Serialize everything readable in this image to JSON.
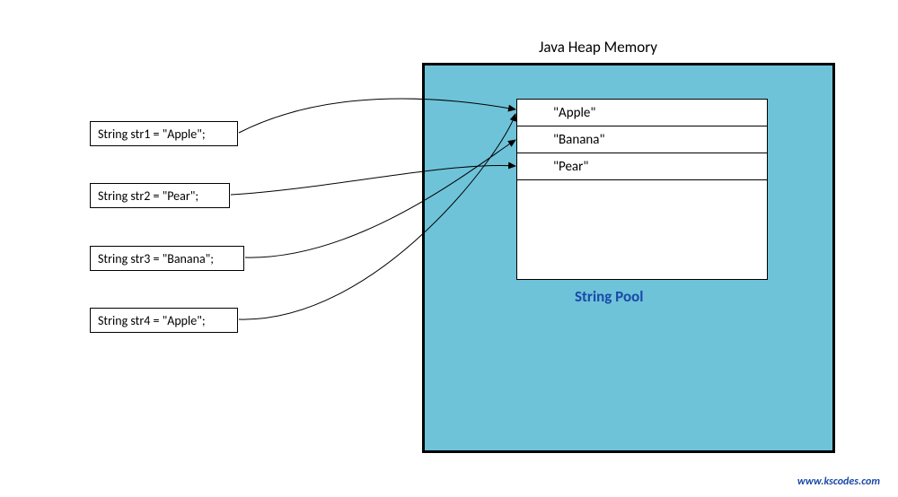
{
  "heap_title": "Java Heap Memory",
  "pool_title": "String Pool",
  "declarations": [
    {
      "code": "String str1 = \"Apple\";"
    },
    {
      "code": "String str2 = \"Pear\";"
    },
    {
      "code": "String str3 = \"Banana\";"
    },
    {
      "code": "String str4 = \"Apple\";"
    }
  ],
  "pool_values": [
    "\"Apple\"",
    "\"Banana\"",
    "\"Pear\""
  ],
  "watermark": "www.kscodes.com"
}
